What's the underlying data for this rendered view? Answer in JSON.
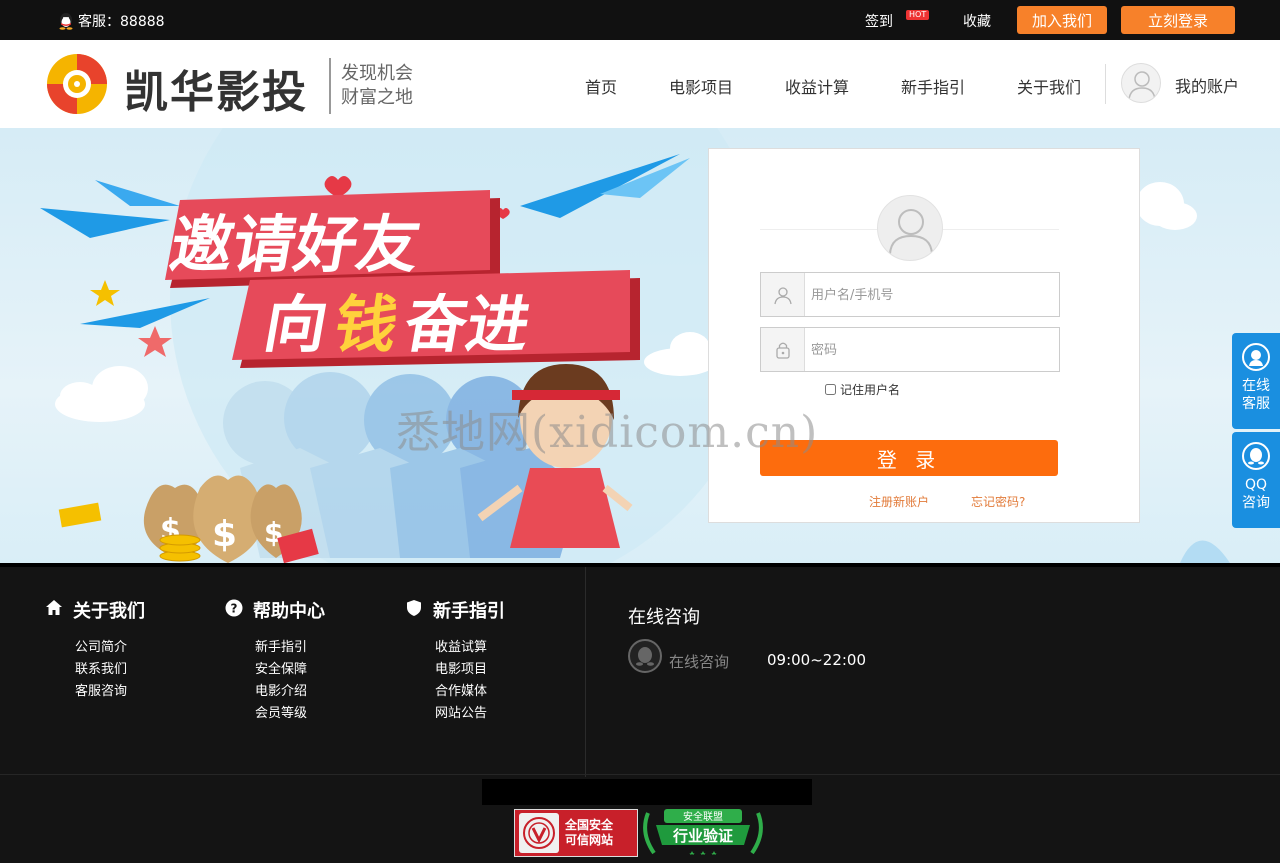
{
  "topbar": {
    "service_label": "客服：88888",
    "signin": "签到",
    "hot_badge": "HOT",
    "favorite": "收藏",
    "join_button": "加入我们",
    "login_button": "立刻登录"
  },
  "header": {
    "logo_text": "凯华影投",
    "slogan_line1": "发现机会",
    "slogan_line2": "财富之地",
    "nav": [
      "首页",
      "电影项目",
      "收益计算",
      "新手指引",
      "关于我们"
    ],
    "account": "我的账户"
  },
  "banner": {
    "headline1": "邀请好友",
    "headline2_a": "向",
    "headline2_b": "钱",
    "headline2_c": "奋进"
  },
  "login": {
    "username_placeholder": "用户名/手机号",
    "password_placeholder": "密码",
    "remember_label": "记住用户名",
    "submit": "登 录",
    "register": "注册新账户",
    "forgot": "忘记密码?"
  },
  "watermark": "悉地网(xidicom.cn)",
  "side": {
    "online_service": [
      "在线",
      "客服"
    ],
    "qq_consult": [
      "QQ",
      "咨询"
    ]
  },
  "footer": {
    "columns": [
      {
        "title": "关于我们",
        "icon": "home-icon",
        "items": [
          "公司简介",
          "联系我们",
          "客服咨询"
        ]
      },
      {
        "title": "帮助中心",
        "icon": "help-icon",
        "items": [
          "新手指引",
          "安全保障",
          "电影介绍",
          "会员等级"
        ]
      },
      {
        "title": "新手指引",
        "icon": "shield-icon",
        "items": [
          "收益试算",
          "电影项目",
          "合作媒体",
          "网站公告"
        ]
      }
    ],
    "consult_title": "在线咨询",
    "consult_label": "在线咨询",
    "consult_hours": "09:00~22:00",
    "badge1_line1": "全国安全",
    "badge1_line2": "可信网站",
    "badge2_top": "安全联盟",
    "badge2_main": "行业验证"
  },
  "colors": {
    "accent_orange": "#f7812a",
    "login_orange": "#fd6c0d",
    "side_blue": "#1a8fe0",
    "banner_red": "#e64a5a"
  }
}
